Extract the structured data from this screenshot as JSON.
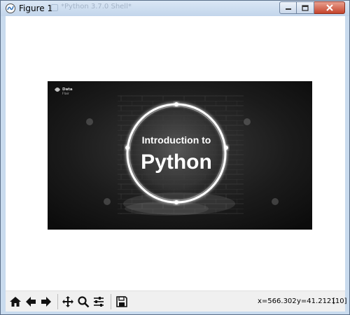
{
  "window": {
    "title": "Figure 1",
    "background_tab": "*Python 3.7.0 Shell*"
  },
  "figure": {
    "image": {
      "logo_text_1": "Data",
      "logo_text_2": "Flair",
      "headline": "Introduction to",
      "subject": "Python"
    }
  },
  "toolbar": {
    "buttons": [
      "home-icon",
      "back-arrow-icon",
      "forward-arrow-icon",
      "pan-icon",
      "zoom-icon",
      "subplots-icon",
      "save-icon"
    ],
    "x_readout": "x=566.302",
    "y_readout": "y=41.2121",
    "value_readout": "[10]"
  },
  "colors": {
    "frame": "#c9dbee",
    "canvas": "#ffffff",
    "toolbar": "#f0f0f0",
    "image_bg": "#1a1a1a",
    "glow": "#ffffff"
  }
}
